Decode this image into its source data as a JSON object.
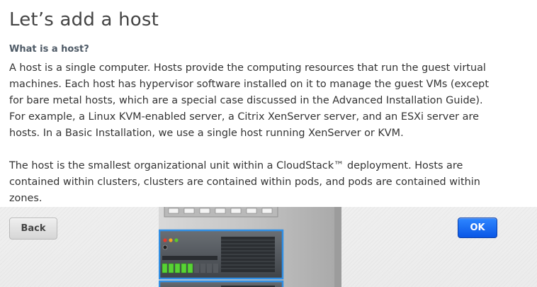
{
  "header": {
    "title": "Let’s add a host",
    "subtitle": "What is a host?"
  },
  "description": {
    "paragraph_1": "A host is a single computer. Hosts provide the computing resources that run the guest virtual machines. Each host has hypervisor software installed on it to manage the guest VMs (except for bare metal hosts, which are a special case discussed in the Advanced Installation Guide). For example, a Linux KVM-enabled server, a Citrix XenServer server, and an ESXi server are hosts. In a Basic Installation, we use a single host running XenServer or KVM.",
    "paragraph_2": "The host is the smallest organizational unit within a CloudStack™ deployment. Hosts are contained within clusters, clusters are contained within pods, and pods are contained within zones."
  },
  "buttons": {
    "back_label": "Back",
    "ok_label": "OK"
  },
  "illustration": {
    "icon": "server-rack-illustration",
    "highlight_color": "#2f8fe6"
  },
  "colors": {
    "primary_button": "#1a6cf2",
    "secondary_button": "#dedede"
  }
}
